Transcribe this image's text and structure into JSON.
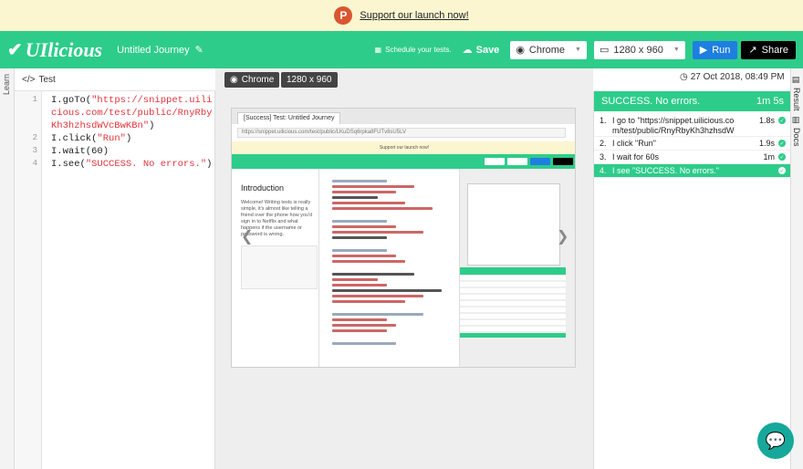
{
  "banner": {
    "link": "Support our launch now!",
    "logo_letter": "P"
  },
  "topbar": {
    "logo": "UIlicious",
    "journey_title": "Untitled Journey",
    "schedule": "Schedule your tests.",
    "save": "Save",
    "browser": "Chrome",
    "resolution": "1280 x 960",
    "run": "Run",
    "share": "Share"
  },
  "left_strip": {
    "learn": "Learn"
  },
  "editor": {
    "tab": "Test",
    "line_numbers": [
      "1",
      "2",
      "3",
      "4"
    ],
    "lines": [
      {
        "pre": "I.goTo(",
        "str": "\"https://snippet.uilicious.com/test/public/RnyRbyKh3hzhsdWVcBwKBn\"",
        "post": ")"
      },
      {
        "pre": "I.click(",
        "str": "\"Run\"",
        "post": ")"
      },
      {
        "pre": "I.wait(60)",
        "str": "",
        "post": ""
      },
      {
        "pre": "I.see(",
        "str": "\"SUCCESS. No errors.\"",
        "post": ")"
      }
    ]
  },
  "preview": {
    "browser": "Chrome",
    "resolution": "1280 x 960",
    "timestamp": "27 Oct 2018, 08:49 PM",
    "shot_tab": "[Success] Test: Untitled Journey",
    "shot_url": "https://snippet.uilicious.com/test/public/LKuDSq6rpka8FUTv8sU5LV",
    "shot_banner": "Support our launch now!",
    "shot_heading": "Introduction",
    "shot_para": "Welcome! Writing tests is really simple, it's almost like telling a friend over the phone how you'd sign in to Netflix and what happens if the username or password is wrong."
  },
  "results": {
    "status": "SUCCESS. No errors.",
    "duration": "1m 5s",
    "rows": [
      {
        "n": "1.",
        "text": "I go to \"https://snippet.uilicious.com/test/public/RnyRbyKh3hzhsdW",
        "dur": "1.8s"
      },
      {
        "n": "2.",
        "text": "I click \"Run\"",
        "dur": "1.9s"
      },
      {
        "n": "3.",
        "text": "I wait for 60s",
        "dur": "1m"
      },
      {
        "n": "4.",
        "text": "I see \"SUCCESS. No errors.\"",
        "dur": ""
      }
    ]
  },
  "right_tabs": {
    "result": "Result",
    "docs": "Docs"
  },
  "colors": {
    "brand": "#2ecc8a",
    "run": "#1e7fe0",
    "string": "#e2333b"
  }
}
